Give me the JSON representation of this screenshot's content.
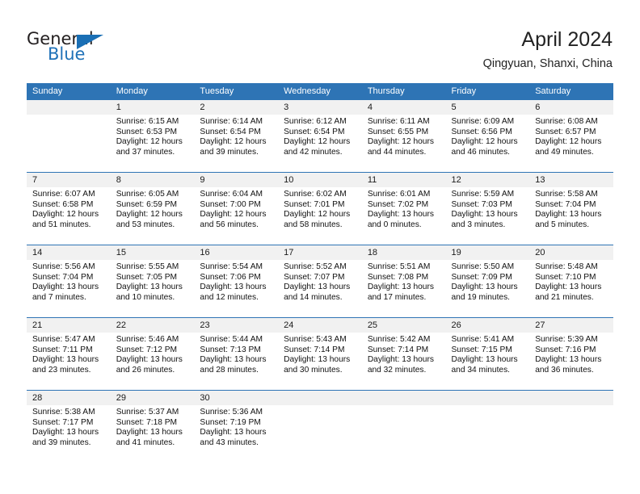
{
  "brand": {
    "name_part1": "General",
    "name_part2": "Blue",
    "triangle_color": "#1a6fb5",
    "text_color": "#231f20",
    "blue_color": "#2072b8"
  },
  "header": {
    "title": "April 2024",
    "location": "Qingyuan, Shanxi, China"
  },
  "theme": {
    "header_blue": "#2e74b5",
    "daynum_band": "#f1f1f1",
    "cell_bg": "#ffffff"
  },
  "weekdays": [
    "Sunday",
    "Monday",
    "Tuesday",
    "Wednesday",
    "Thursday",
    "Friday",
    "Saturday"
  ],
  "weeks": [
    [
      {
        "day": "",
        "sunrise": "",
        "sunset": "",
        "daylight_line1": "",
        "daylight_line2": ""
      },
      {
        "day": "1",
        "sunrise": "Sunrise: 6:15 AM",
        "sunset": "Sunset: 6:53 PM",
        "daylight_line1": "Daylight: 12 hours",
        "daylight_line2": "and 37 minutes."
      },
      {
        "day": "2",
        "sunrise": "Sunrise: 6:14 AM",
        "sunset": "Sunset: 6:54 PM",
        "daylight_line1": "Daylight: 12 hours",
        "daylight_line2": "and 39 minutes."
      },
      {
        "day": "3",
        "sunrise": "Sunrise: 6:12 AM",
        "sunset": "Sunset: 6:54 PM",
        "daylight_line1": "Daylight: 12 hours",
        "daylight_line2": "and 42 minutes."
      },
      {
        "day": "4",
        "sunrise": "Sunrise: 6:11 AM",
        "sunset": "Sunset: 6:55 PM",
        "daylight_line1": "Daylight: 12 hours",
        "daylight_line2": "and 44 minutes."
      },
      {
        "day": "5",
        "sunrise": "Sunrise: 6:09 AM",
        "sunset": "Sunset: 6:56 PM",
        "daylight_line1": "Daylight: 12 hours",
        "daylight_line2": "and 46 minutes."
      },
      {
        "day": "6",
        "sunrise": "Sunrise: 6:08 AM",
        "sunset": "Sunset: 6:57 PM",
        "daylight_line1": "Daylight: 12 hours",
        "daylight_line2": "and 49 minutes."
      }
    ],
    [
      {
        "day": "7",
        "sunrise": "Sunrise: 6:07 AM",
        "sunset": "Sunset: 6:58 PM",
        "daylight_line1": "Daylight: 12 hours",
        "daylight_line2": "and 51 minutes."
      },
      {
        "day": "8",
        "sunrise": "Sunrise: 6:05 AM",
        "sunset": "Sunset: 6:59 PM",
        "daylight_line1": "Daylight: 12 hours",
        "daylight_line2": "and 53 minutes."
      },
      {
        "day": "9",
        "sunrise": "Sunrise: 6:04 AM",
        "sunset": "Sunset: 7:00 PM",
        "daylight_line1": "Daylight: 12 hours",
        "daylight_line2": "and 56 minutes."
      },
      {
        "day": "10",
        "sunrise": "Sunrise: 6:02 AM",
        "sunset": "Sunset: 7:01 PM",
        "daylight_line1": "Daylight: 12 hours",
        "daylight_line2": "and 58 minutes."
      },
      {
        "day": "11",
        "sunrise": "Sunrise: 6:01 AM",
        "sunset": "Sunset: 7:02 PM",
        "daylight_line1": "Daylight: 13 hours",
        "daylight_line2": "and 0 minutes."
      },
      {
        "day": "12",
        "sunrise": "Sunrise: 5:59 AM",
        "sunset": "Sunset: 7:03 PM",
        "daylight_line1": "Daylight: 13 hours",
        "daylight_line2": "and 3 minutes."
      },
      {
        "day": "13",
        "sunrise": "Sunrise: 5:58 AM",
        "sunset": "Sunset: 7:04 PM",
        "daylight_line1": "Daylight: 13 hours",
        "daylight_line2": "and 5 minutes."
      }
    ],
    [
      {
        "day": "14",
        "sunrise": "Sunrise: 5:56 AM",
        "sunset": "Sunset: 7:04 PM",
        "daylight_line1": "Daylight: 13 hours",
        "daylight_line2": "and 7 minutes."
      },
      {
        "day": "15",
        "sunrise": "Sunrise: 5:55 AM",
        "sunset": "Sunset: 7:05 PM",
        "daylight_line1": "Daylight: 13 hours",
        "daylight_line2": "and 10 minutes."
      },
      {
        "day": "16",
        "sunrise": "Sunrise: 5:54 AM",
        "sunset": "Sunset: 7:06 PM",
        "daylight_line1": "Daylight: 13 hours",
        "daylight_line2": "and 12 minutes."
      },
      {
        "day": "17",
        "sunrise": "Sunrise: 5:52 AM",
        "sunset": "Sunset: 7:07 PM",
        "daylight_line1": "Daylight: 13 hours",
        "daylight_line2": "and 14 minutes."
      },
      {
        "day": "18",
        "sunrise": "Sunrise: 5:51 AM",
        "sunset": "Sunset: 7:08 PM",
        "daylight_line1": "Daylight: 13 hours",
        "daylight_line2": "and 17 minutes."
      },
      {
        "day": "19",
        "sunrise": "Sunrise: 5:50 AM",
        "sunset": "Sunset: 7:09 PM",
        "daylight_line1": "Daylight: 13 hours",
        "daylight_line2": "and 19 minutes."
      },
      {
        "day": "20",
        "sunrise": "Sunrise: 5:48 AM",
        "sunset": "Sunset: 7:10 PM",
        "daylight_line1": "Daylight: 13 hours",
        "daylight_line2": "and 21 minutes."
      }
    ],
    [
      {
        "day": "21",
        "sunrise": "Sunrise: 5:47 AM",
        "sunset": "Sunset: 7:11 PM",
        "daylight_line1": "Daylight: 13 hours",
        "daylight_line2": "and 23 minutes."
      },
      {
        "day": "22",
        "sunrise": "Sunrise: 5:46 AM",
        "sunset": "Sunset: 7:12 PM",
        "daylight_line1": "Daylight: 13 hours",
        "daylight_line2": "and 26 minutes."
      },
      {
        "day": "23",
        "sunrise": "Sunrise: 5:44 AM",
        "sunset": "Sunset: 7:13 PM",
        "daylight_line1": "Daylight: 13 hours",
        "daylight_line2": "and 28 minutes."
      },
      {
        "day": "24",
        "sunrise": "Sunrise: 5:43 AM",
        "sunset": "Sunset: 7:14 PM",
        "daylight_line1": "Daylight: 13 hours",
        "daylight_line2": "and 30 minutes."
      },
      {
        "day": "25",
        "sunrise": "Sunrise: 5:42 AM",
        "sunset": "Sunset: 7:14 PM",
        "daylight_line1": "Daylight: 13 hours",
        "daylight_line2": "and 32 minutes."
      },
      {
        "day": "26",
        "sunrise": "Sunrise: 5:41 AM",
        "sunset": "Sunset: 7:15 PM",
        "daylight_line1": "Daylight: 13 hours",
        "daylight_line2": "and 34 minutes."
      },
      {
        "day": "27",
        "sunrise": "Sunrise: 5:39 AM",
        "sunset": "Sunset: 7:16 PM",
        "daylight_line1": "Daylight: 13 hours",
        "daylight_line2": "and 36 minutes."
      }
    ],
    [
      {
        "day": "28",
        "sunrise": "Sunrise: 5:38 AM",
        "sunset": "Sunset: 7:17 PM",
        "daylight_line1": "Daylight: 13 hours",
        "daylight_line2": "and 39 minutes."
      },
      {
        "day": "29",
        "sunrise": "Sunrise: 5:37 AM",
        "sunset": "Sunset: 7:18 PM",
        "daylight_line1": "Daylight: 13 hours",
        "daylight_line2": "and 41 minutes."
      },
      {
        "day": "30",
        "sunrise": "Sunrise: 5:36 AM",
        "sunset": "Sunset: 7:19 PM",
        "daylight_line1": "Daylight: 13 hours",
        "daylight_line2": "and 43 minutes."
      },
      {
        "day": "",
        "sunrise": "",
        "sunset": "",
        "daylight_line1": "",
        "daylight_line2": ""
      },
      {
        "day": "",
        "sunrise": "",
        "sunset": "",
        "daylight_line1": "",
        "daylight_line2": ""
      },
      {
        "day": "",
        "sunrise": "",
        "sunset": "",
        "daylight_line1": "",
        "daylight_line2": ""
      },
      {
        "day": "",
        "sunrise": "",
        "sunset": "",
        "daylight_line1": "",
        "daylight_line2": ""
      }
    ]
  ]
}
